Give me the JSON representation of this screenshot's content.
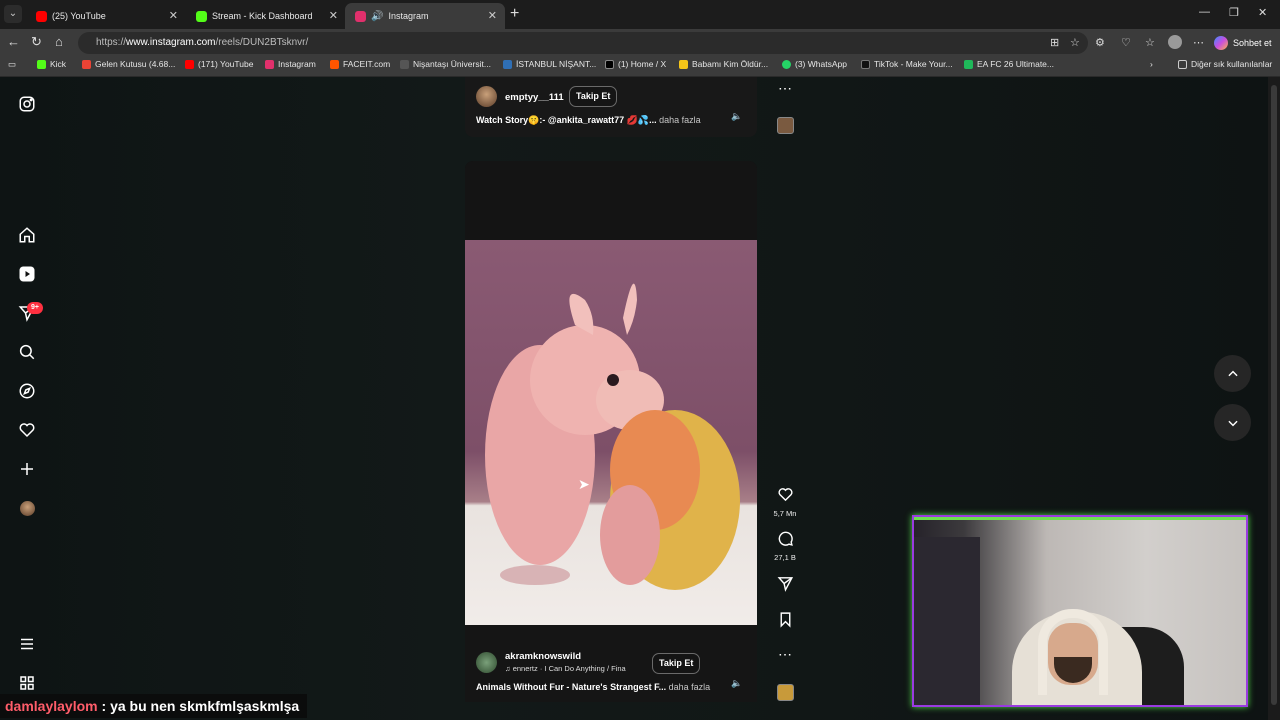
{
  "browser": {
    "tabs": [
      {
        "label": "(25) YouTube",
        "favicon_color": "#ff0000",
        "active": false
      },
      {
        "label": "Stream - Kick Dashboard",
        "favicon_color": "#53fc18",
        "active": false
      },
      {
        "label": "Instagram",
        "favicon_color": "#e1306c",
        "active": true
      }
    ],
    "url_prefix": "https://",
    "url_host": "www.instagram.com",
    "url_path": "/reels/DUN2BTsknvr/",
    "copilot_label": "Sohbet et",
    "bookmarks": [
      {
        "label": "Kick",
        "color": "#53fc18"
      },
      {
        "label": "Gelen Kutusu (4.68...",
        "color": "#ea4335"
      },
      {
        "label": "(171) YouTube",
        "color": "#ff0000"
      },
      {
        "label": "Instagram",
        "color": "#e1306c"
      },
      {
        "label": "FACEIT.com",
        "color": "#ff5500"
      },
      {
        "label": "Nişantaşı Üniversit...",
        "color": "#555555"
      },
      {
        "label": "İSTANBUL NİŞANT...",
        "color": "#2f6fb5"
      },
      {
        "label": "(1) Home / X",
        "color": "#000000"
      },
      {
        "label": "Babamı Kim Öldür...",
        "color": "#f5c518"
      },
      {
        "label": "(3) WhatsApp",
        "color": "#25d366"
      },
      {
        "label": "TikTok - Make Your...",
        "color": "#111111"
      },
      {
        "label": "EA FC 26 Ultimate...",
        "color": "#1fb85a"
      }
    ],
    "other_bookmarks": "Diğer sık kullanılanlar"
  },
  "instagram": {
    "sidebar": {
      "notification_badge": "9+"
    },
    "reel_previous": {
      "username": "emptyy__111",
      "follow_label": "Takip Et",
      "caption_text": "Watch Story🤫:- @ankita_rawatt77 💋💦...",
      "more_label": "daha fazla"
    },
    "reel_current": {
      "username": "akramknowswild",
      "audio": "ennertz · I Can Do Anything / Fina",
      "follow_label": "Takip Et",
      "caption_text": "Animals Without Fur - Nature's Strangest F...",
      "more_label": "daha fazla",
      "likes": "5,7 Mn",
      "comments": "27,1 B"
    }
  },
  "stream_overlay": {
    "chat_user": "damlaylaylom",
    "chat_separator": " : ",
    "chat_message": "ya bu nen skmkfmlşaskmlşa"
  }
}
